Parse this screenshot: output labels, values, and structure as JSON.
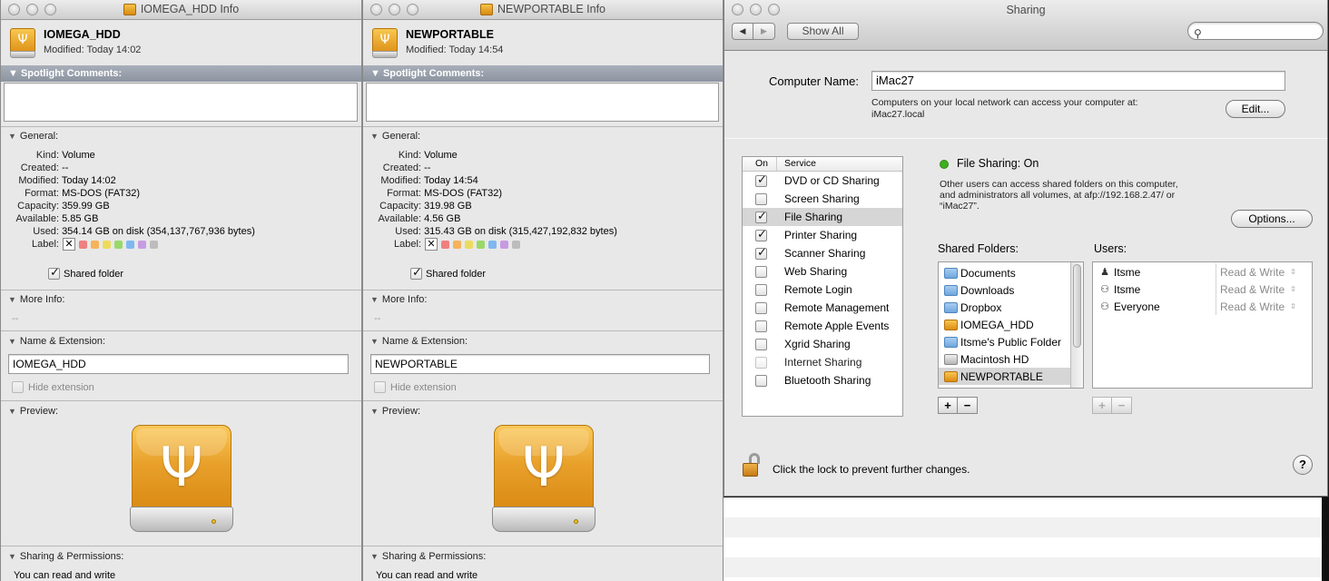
{
  "info_windows": [
    {
      "title": "IOMEGA_HDD Info",
      "name": "IOMEGA_HDD",
      "modified_line": "Modified: Today 14:02",
      "spotlight_label": "▼ Spotlight Comments:",
      "general_label": "General:",
      "general": [
        {
          "key": "Kind:",
          "value": "Volume"
        },
        {
          "key": "Created:",
          "value": "--"
        },
        {
          "key": "Modified:",
          "value": "Today 14:02"
        },
        {
          "key": "Format:",
          "value": "MS-DOS (FAT32)"
        },
        {
          "key": "Capacity:",
          "value": "359.99 GB"
        },
        {
          "key": "Available:",
          "value": "5.85 GB"
        },
        {
          "key": "Used:",
          "value": "354.14 GB on disk (354,137,767,936 bytes)"
        }
      ],
      "label_key": "Label:",
      "shared_folder": "Shared folder",
      "more_info_label": "More Info:",
      "more_info_value": "--",
      "name_ext_label": "Name & Extension:",
      "name_value": "IOMEGA_HDD",
      "hide_extension": "Hide extension",
      "preview_label": "Preview:",
      "sharing_label": "Sharing & Permissions:",
      "perm_text": "You can read and write"
    },
    {
      "title": "NEWPORTABLE Info",
      "name": "NEWPORTABLE",
      "modified_line": "Modified: Today 14:54",
      "spotlight_label": "▼ Spotlight Comments:",
      "general_label": "General:",
      "general": [
        {
          "key": "Kind:",
          "value": "Volume"
        },
        {
          "key": "Created:",
          "value": "--"
        },
        {
          "key": "Modified:",
          "value": "Today 14:54"
        },
        {
          "key": "Format:",
          "value": "MS-DOS (FAT32)"
        },
        {
          "key": "Capacity:",
          "value": "319.98 GB"
        },
        {
          "key": "Available:",
          "value": "4.56 GB"
        },
        {
          "key": "Used:",
          "value": "315.43 GB on disk (315,427,192,832 bytes)"
        }
      ],
      "label_key": "Label:",
      "shared_folder": "Shared folder",
      "more_info_label": "More Info:",
      "more_info_value": "--",
      "name_ext_label": "Name & Extension:",
      "name_value": "NEWPORTABLE",
      "hide_extension": "Hide extension",
      "preview_label": "Preview:",
      "sharing_label": "Sharing & Permissions:",
      "perm_text": "You can read and write"
    }
  ],
  "label_colors": [
    "#f07f7f",
    "#f5b35a",
    "#ecdb5e",
    "#9bd86a",
    "#7fb8ef",
    "#c79be2",
    "#bdbdbd"
  ],
  "sharing": {
    "title": "Sharing",
    "show_all": "Show All",
    "back_icon": "◀",
    "forward_icon": "▶",
    "computer_name_label": "Computer Name:",
    "computer_name_value": "iMac27",
    "computer_note_1": "Computers on your local network can access your computer at:",
    "computer_note_2": "iMac27.local",
    "edit_button": "Edit...",
    "col_on": "On",
    "col_service": "Service",
    "services": [
      {
        "label": "DVD or CD Sharing",
        "on": true
      },
      {
        "label": "Screen Sharing",
        "on": false
      },
      {
        "label": "File Sharing",
        "on": true,
        "selected": true
      },
      {
        "label": "Printer Sharing",
        "on": true
      },
      {
        "label": "Scanner Sharing",
        "on": true
      },
      {
        "label": "Web Sharing",
        "on": false
      },
      {
        "label": "Remote Login",
        "on": false
      },
      {
        "label": "Remote Management",
        "on": false
      },
      {
        "label": "Remote Apple Events",
        "on": false
      },
      {
        "label": "Xgrid Sharing",
        "on": false
      },
      {
        "label": "Internet Sharing",
        "on": false,
        "dim": true
      },
      {
        "label": "Bluetooth Sharing",
        "on": false
      }
    ],
    "status_text": "File Sharing: On",
    "status_color": "#3fae22",
    "desc_1": "Other users can access shared folders on this computer,",
    "desc_2": "and administrators all volumes, at afp://192.168.2.47/ or",
    "desc_3": "“iMac27”.",
    "options_button": "Options...",
    "shared_folders_label": "Shared Folders:",
    "users_label": "Users:",
    "shared_folders": [
      {
        "label": "Documents",
        "icon": "blue"
      },
      {
        "label": "Downloads",
        "icon": "blue"
      },
      {
        "label": "Dropbox",
        "icon": "blue"
      },
      {
        "label": "IOMEGA_HDD",
        "icon": "orange"
      },
      {
        "label": "Itsme's Public Folder",
        "icon": "blue"
      },
      {
        "label": "Macintosh HD",
        "icon": "grey"
      },
      {
        "label": "NEWPORTABLE",
        "icon": "orange",
        "selected": true
      }
    ],
    "users": [
      {
        "label": "Itsme",
        "icon": "person-icon",
        "perm": "Read & Write"
      },
      {
        "label": "Itsme",
        "icon": "group-icon",
        "perm": "Read & Write"
      },
      {
        "label": "Everyone",
        "icon": "everyone-icon",
        "perm": "Read & Write"
      }
    ],
    "plus": "+",
    "minus": "−",
    "lock_text": "Click the lock to prevent further changes.",
    "help": "?"
  }
}
